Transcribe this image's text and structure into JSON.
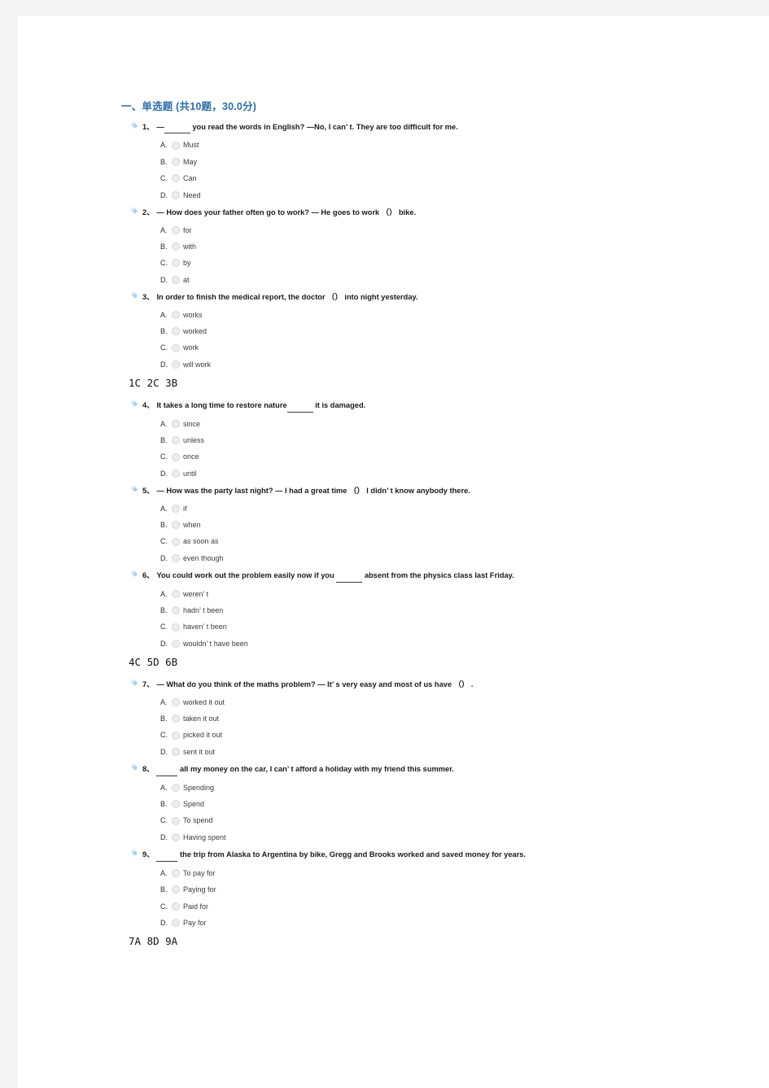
{
  "section": {
    "title": "一、单选题 (共10题，30.0分)"
  },
  "icons": {
    "pin": "pin-icon"
  },
  "colors": {
    "section_title": "#2e6da4",
    "page_background": "#ffffff",
    "canvas_background": "#f4f4f4",
    "radio_fill": "#ededed",
    "body_text": "#3a3a3a"
  },
  "questions": [
    {
      "number": "1、",
      "stem_parts": [
        {
          "t": "text",
          "v": "—"
        },
        {
          "t": "blank",
          "size": "b-md"
        },
        {
          "t": "text",
          "v": " you read the words in English? —No, I can’ t. They are too difficult for me."
        }
      ],
      "options": [
        {
          "letter": "A.",
          "label": "Must"
        },
        {
          "letter": "B.",
          "label": "May"
        },
        {
          "letter": "C.",
          "label": "Can"
        },
        {
          "letter": "D.",
          "label": "Need"
        }
      ]
    },
    {
      "number": "2、",
      "stem_parts": [
        {
          "t": "text",
          "v": "— How does your father often go to work? — He goes to work （） bike."
        }
      ],
      "options": [
        {
          "letter": "A.",
          "label": "for"
        },
        {
          "letter": "B.",
          "label": "with"
        },
        {
          "letter": "C.",
          "label": "by"
        },
        {
          "letter": "D.",
          "label": "at"
        }
      ]
    },
    {
      "number": "3、",
      "stem_parts": [
        {
          "t": "text",
          "v": "In order to finish the medical report, the doctor （） into night yesterday."
        }
      ],
      "options": [
        {
          "letter": "A.",
          "label": "works"
        },
        {
          "letter": "B.",
          "label": "worked"
        },
        {
          "letter": "C.",
          "label": "work"
        },
        {
          "letter": "D.",
          "label": "will work"
        }
      ]
    },
    {
      "number": "4、",
      "stem_parts": [
        {
          "t": "text",
          "v": "It takes a long time to restore nature"
        },
        {
          "t": "blank",
          "size": "b-md"
        },
        {
          "t": "text",
          "v": " it is damaged."
        }
      ],
      "options": [
        {
          "letter": "A.",
          "label": "since"
        },
        {
          "letter": "B.",
          "label": "unless"
        },
        {
          "letter": "C.",
          "label": "once"
        },
        {
          "letter": "D.",
          "label": "until"
        }
      ]
    },
    {
      "number": "5、",
      "stem_parts": [
        {
          "t": "text",
          "v": "— How was the party last night? — I had a great time （） I didn’ t know anybody there."
        }
      ],
      "options": [
        {
          "letter": "A.",
          "label": "if"
        },
        {
          "letter": "B.",
          "label": "when"
        },
        {
          "letter": "C.",
          "label": "as soon as"
        },
        {
          "letter": "D.",
          "label": "even though"
        }
      ]
    },
    {
      "number": "6、",
      "stem_parts": [
        {
          "t": "text",
          "v": "You could work out the problem easily now if you "
        },
        {
          "t": "blank",
          "size": "b-md"
        },
        {
          "t": "text",
          "v": " absent from the physics class last Friday."
        }
      ],
      "options": [
        {
          "letter": "A.",
          "label": "weren’ t"
        },
        {
          "letter": "B.",
          "label": "hadn’ t been"
        },
        {
          "letter": "C.",
          "label": "haven’ t been"
        },
        {
          "letter": "D.",
          "label": "wouldn’ t have been"
        }
      ]
    },
    {
      "number": "7、",
      "stem_parts": [
        {
          "t": "text",
          "v": "— What do you think of the maths problem? — It’ s very easy and most of us have （） ."
        }
      ],
      "options": [
        {
          "letter": "A.",
          "label": "worked it out"
        },
        {
          "letter": "B.",
          "label": "taken it out"
        },
        {
          "letter": "C.",
          "label": "picked it out"
        },
        {
          "letter": "D.",
          "label": "sent it out"
        }
      ]
    },
    {
      "number": "8、",
      "stem_parts": [
        {
          "t": "blank",
          "size": "b-sm"
        },
        {
          "t": "text",
          "v": " all my money on the car, I can’ t afford a holiday with my friend this summer."
        }
      ],
      "options": [
        {
          "letter": "A.",
          "label": "Spending"
        },
        {
          "letter": "B.",
          "label": "Spend"
        },
        {
          "letter": "C.",
          "label": "To spend"
        },
        {
          "letter": "D.",
          "label": "Having spent"
        }
      ]
    },
    {
      "number": "9、",
      "stem_parts": [
        {
          "t": "blank",
          "size": "b-sm"
        },
        {
          "t": "text",
          "v": " the trip from Alaska to Argentina by bike, Gregg and Brooks worked and saved money for years."
        }
      ],
      "options": [
        {
          "letter": "A.",
          "label": "To pay for"
        },
        {
          "letter": "B.",
          "label": "Paying for"
        },
        {
          "letter": "C.",
          "label": "Paid for"
        },
        {
          "letter": "D.",
          "label": "Pay for"
        }
      ]
    }
  ],
  "answer_lines": [
    {
      "after_question": 3,
      "text": "1C 2C 3B"
    },
    {
      "after_question": 6,
      "text": "4C 5D 6B"
    },
    {
      "after_question": 9,
      "text": "7A 8D 9A"
    }
  ]
}
